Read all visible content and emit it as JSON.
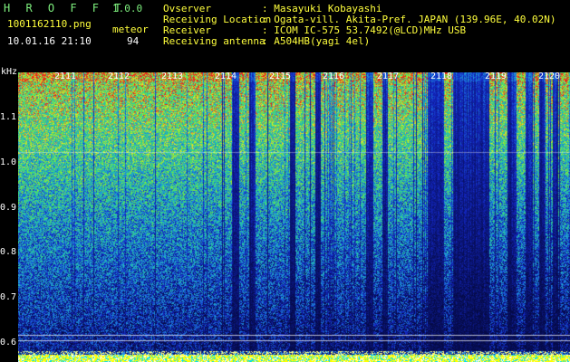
{
  "header": {
    "app_title": "H R O F F T",
    "app_version": "1.0.0",
    "filename": "1001162110.png",
    "datetime": "10.01.16 21:10",
    "meteor_label": "meteor",
    "meteor_count": "94"
  },
  "station_info": [
    {
      "label": "Ovserver",
      "value": ": Masayuki Kobayashi"
    },
    {
      "label": "Receiving Location",
      "value": ": Ogata-vill. Akita-Pref. JAPAN (139.96E, 40.02N)"
    },
    {
      "label": "Receiver",
      "value": ": ICOM IC-575 53.7492(@LCD)MHz USB"
    },
    {
      "label": "Receiving antenna",
      "value": ": A504HB(yagi 4el)"
    }
  ],
  "axes": {
    "y_unit": "kHz",
    "y_ticks": [
      "1.1",
      "1.0",
      "0.9",
      "0.8",
      "0.7",
      "0.6"
    ],
    "x_ticks": [
      "2111",
      "2112",
      "2113",
      "2114",
      "2115",
      "2116",
      "2117",
      "2118",
      "2119",
      "2120"
    ]
  },
  "colors": {
    "label_yellow": "#ffff3c",
    "title_green": "#7ef07e",
    "text_white": "#ffffff",
    "background": "#000000"
  }
}
